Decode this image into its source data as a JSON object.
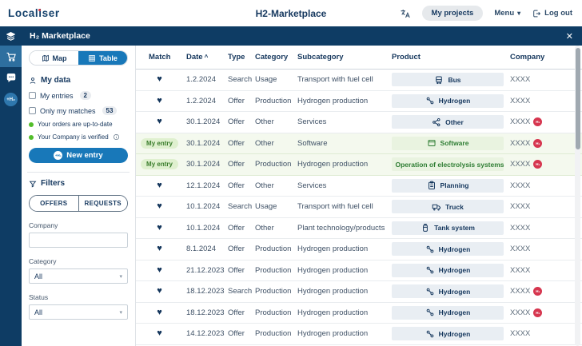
{
  "icons": {
    "close": "✕",
    "heart": "♥",
    "sort_asc": "^",
    "chevron_down": "▾",
    "select_caret": "▾",
    "info": "ⓘ",
    "h2_plus": "+H₂"
  },
  "header": {
    "logo": "Localiser",
    "title": "H2-Marketplace",
    "my_projects_label": "My projects",
    "menu_label": "Menu",
    "logout_label": "Log out"
  },
  "titlebar": {
    "title": "H₂ Marketplace"
  },
  "sidebar": {
    "items": [
      {
        "icon": "cart-icon",
        "selected": true
      },
      {
        "icon": "chat-icon",
        "selected": false
      },
      {
        "icon": "h2-plus-bubble",
        "selected": false
      }
    ]
  },
  "panel": {
    "view_toggle": {
      "map_label": "Map",
      "table_label": "Table",
      "selected": "table"
    },
    "my_data": {
      "title": "My data",
      "entries_label": "My entries",
      "entries_count": "2",
      "matches_label": "Only my matches",
      "matches_count": "53",
      "status_orders": "Your orders are up-to-date",
      "status_verified": "Your Company is verified"
    },
    "new_entry_label": "New entry",
    "filters": {
      "title": "Filters",
      "offers_label": "OFFERS",
      "requests_label": "REQUESTS",
      "company_label": "Company",
      "company_value": "",
      "category_label": "Category",
      "category_value": "All",
      "status_label": "Status",
      "status_value": "All"
    }
  },
  "table": {
    "columns": {
      "match": "Match",
      "date": "Date",
      "type": "Type",
      "category": "Category",
      "subcategory": "Subcategory",
      "product": "Product",
      "company": "Company"
    },
    "sort_column": "Date",
    "my_entry_label": "My entry",
    "rows": [
      {
        "match": "heart",
        "date": "1.2.2024",
        "type": "Search",
        "category": "Usage",
        "subcategory": "Transport with fuel cell",
        "product": {
          "icon": "bus-icon",
          "label": "Bus"
        },
        "company": "XXXX",
        "company_badge": false,
        "highlighted": false
      },
      {
        "match": "heart",
        "date": "1.2.2024",
        "type": "Offer",
        "category": "Production",
        "subcategory": "Hydrogen production",
        "product": {
          "icon": "hydrogen-icon",
          "label": "Hydrogen"
        },
        "company": "XXXX",
        "company_badge": false,
        "highlighted": false
      },
      {
        "match": "heart",
        "date": "30.1.2024",
        "type": "Offer",
        "category": "Other",
        "subcategory": "Services",
        "product": {
          "icon": "share-icon",
          "label": "Other"
        },
        "company": "XXXX",
        "company_badge": true,
        "highlighted": false
      },
      {
        "match": "my-entry",
        "date": "30.1.2024",
        "type": "Offer",
        "category": "Other",
        "subcategory": "Software",
        "product": {
          "icon": "software-icon",
          "label": "Software"
        },
        "company": "XXXX",
        "company_badge": true,
        "highlighted": true
      },
      {
        "match": "my-entry",
        "date": "30.1.2024",
        "type": "Offer",
        "category": "Production",
        "subcategory": "Hydrogen production",
        "product": {
          "icon": "h2-icon",
          "label": "Operation of electrolysis systems"
        },
        "company": "XXXX",
        "company_badge": true,
        "highlighted": true
      },
      {
        "match": "heart",
        "date": "12.1.2024",
        "type": "Offer",
        "category": "Other",
        "subcategory": "Services",
        "product": {
          "icon": "planning-icon",
          "label": "Planning"
        },
        "company": "XXXX",
        "company_badge": false,
        "highlighted": false
      },
      {
        "match": "heart",
        "date": "10.1.2024",
        "type": "Search",
        "category": "Usage",
        "subcategory": "Transport with fuel cell",
        "product": {
          "icon": "truck-icon",
          "label": "Truck"
        },
        "company": "XXXX",
        "company_badge": false,
        "highlighted": false
      },
      {
        "match": "heart",
        "date": "10.1.2024",
        "type": "Offer",
        "category": "Other",
        "subcategory": "Plant technology/products",
        "product": {
          "icon": "tank-icon",
          "label": "Tank system"
        },
        "company": "XXXX",
        "company_badge": false,
        "highlighted": false
      },
      {
        "match": "heart",
        "date": "8.1.2024",
        "type": "Offer",
        "category": "Production",
        "subcategory": "Hydrogen production",
        "product": {
          "icon": "hydrogen-icon",
          "label": "Hydrogen"
        },
        "company": "XXXX",
        "company_badge": false,
        "highlighted": false
      },
      {
        "match": "heart",
        "date": "21.12.2023",
        "type": "Offer",
        "category": "Production",
        "subcategory": "Hydrogen production",
        "product": {
          "icon": "hydrogen-icon",
          "label": "Hydrogen"
        },
        "company": "XXXX",
        "company_badge": false,
        "highlighted": false
      },
      {
        "match": "heart",
        "date": "18.12.2023",
        "type": "Search",
        "category": "Production",
        "subcategory": "Hydrogen production",
        "product": {
          "icon": "hydrogen-icon",
          "label": "Hydrogen"
        },
        "company": "XXXX",
        "company_badge": true,
        "highlighted": false
      },
      {
        "match": "heart",
        "date": "18.12.2023",
        "type": "Offer",
        "category": "Production",
        "subcategory": "Hydrogen production",
        "product": {
          "icon": "hydrogen-icon",
          "label": "Hydrogen"
        },
        "company": "XXXX",
        "company_badge": true,
        "highlighted": false
      },
      {
        "match": "heart",
        "date": "14.12.2023",
        "type": "Offer",
        "category": "Production",
        "subcategory": "Hydrogen production",
        "product": {
          "icon": "hydrogen-icon",
          "label": "Hydrogen"
        },
        "company": "XXXX",
        "company_badge": false,
        "highlighted": false
      }
    ]
  },
  "colors": {
    "navy": "#0e3c64",
    "accent_blue": "#1878b9",
    "green_dot": "#52bd2a",
    "my_entry_green": "#3a7d2c",
    "badge_red": "#d6364f"
  }
}
